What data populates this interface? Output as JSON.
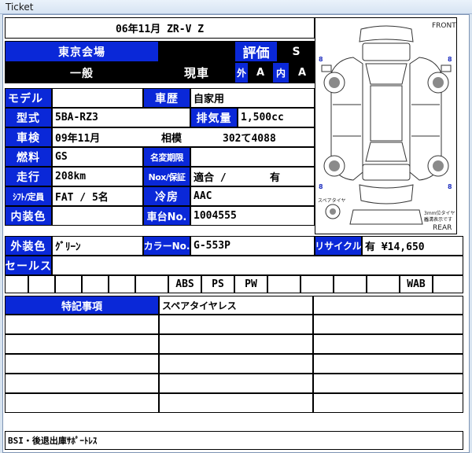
{
  "window": {
    "title": "Ticket"
  },
  "header": {
    "year_model": "06年11月  ZR-V Z"
  },
  "venue": {
    "name": "東京会場",
    "category": "一般"
  },
  "grade": {
    "label": "評価",
    "value": "S"
  },
  "condition": {
    "label": "現車",
    "exterior_label": "外",
    "exterior_value": "A",
    "interior_label": "内",
    "interior_value": "A"
  },
  "specs": {
    "model_label": "モデル",
    "model_value": "",
    "history_label": "車歴",
    "history_value": "自家用",
    "type_label": "型式",
    "type_value": "5BA-RZ3",
    "displacement_label": "排気量",
    "displacement_value": "1,500cc",
    "inspection_label": "車検",
    "inspection_value": "09年11月",
    "region_label": "相模",
    "plate_value": "302て4088",
    "fuel_label": "燃料",
    "fuel_value": "GS",
    "name_change_label": "名変期限",
    "name_change_value": "",
    "mileage_label": "走行",
    "mileage_value": "208km",
    "nox_label": "Nox/保証",
    "nox_value": "適合 /",
    "warranty_value": "有",
    "shift_label": "ｼﾌﾄ/定員",
    "shift_value": "FAT  /  5名",
    "ac_label": "冷房",
    "ac_value": "AAC",
    "interior_color_label": "内装色",
    "interior_color_value": "",
    "chassis_label": "車台No.",
    "chassis_value": "1004555",
    "exterior_color_label": "外装色",
    "exterior_color_value": "ｸﾞﾘｰﾝ",
    "color_no_label": "カラーNo.",
    "color_no_value": "G-553P",
    "recycle_label": "リサイクル",
    "recycle_value": "有 ¥14,650",
    "sales_label": "セールス",
    "sales_value": ""
  },
  "equipment": [
    "ABS",
    "PS",
    "PW",
    "WAB"
  ],
  "notes": {
    "header": "特記事項",
    "first": "スペアタイヤレス",
    "footer": "BSI・後退出庫ｻﾎﾟｰﾄﾚｽ"
  },
  "diagram": {
    "front": "FRONT",
    "rear": "REAR",
    "tire_value": "8",
    "spare_label": "スペアタイヤ",
    "tread_note_1": "3mm位タイヤの",
    "tread_note_2": "残溝表示です"
  }
}
